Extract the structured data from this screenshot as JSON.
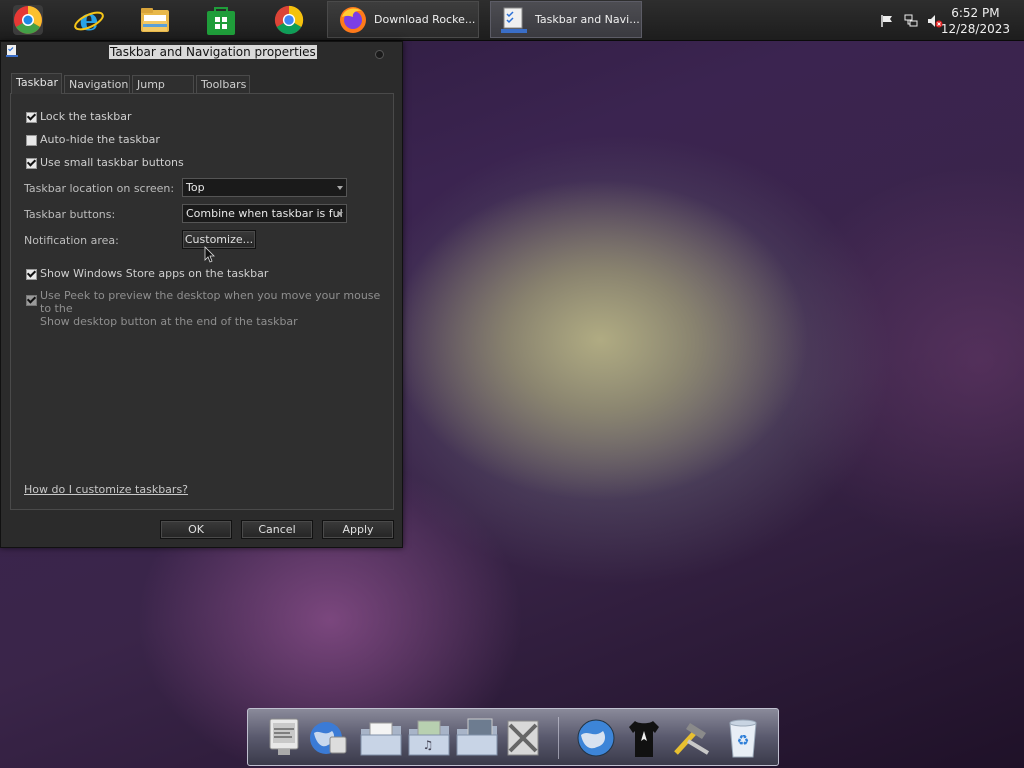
{
  "taskbar": {
    "pinned": [
      {
        "name": "chrome-canary",
        "icon": "chrome-color-icon"
      },
      {
        "name": "internet-explorer",
        "icon": "ie-icon"
      },
      {
        "name": "file-explorer",
        "icon": "folder-icon"
      },
      {
        "name": "windows-store",
        "icon": "store-icon"
      },
      {
        "name": "google-chrome",
        "icon": "chrome-icon"
      }
    ],
    "tasks": [
      {
        "label": "Download Rocke...",
        "icon": "firefox-icon",
        "active": false
      },
      {
        "label": "Taskbar and Navi...",
        "icon": "taskbar-properties-icon",
        "active": true
      }
    ],
    "tray": {
      "icons": [
        "flag-icon",
        "network-icon",
        "volume-muted-icon"
      ],
      "time": "6:52 PM",
      "date": "12/28/2023"
    }
  },
  "dialog": {
    "title": "Taskbar and Navigation properties",
    "tabs": [
      "Taskbar",
      "Navigation",
      "Jump Lists",
      "Toolbars"
    ],
    "selected_tab": "Taskbar",
    "checkboxes": {
      "lock": {
        "label": "Lock the taskbar",
        "checked": true
      },
      "autohide": {
        "label": "Auto-hide the taskbar",
        "checked": false
      },
      "small_buttons": {
        "label": "Use small taskbar buttons",
        "checked": true
      },
      "store_apps": {
        "label": "Show Windows Store apps on the taskbar",
        "checked": true
      },
      "peek": {
        "label_line1": "Use Peek to preview the desktop when you move your mouse to the",
        "label_line2": "Show desktop button at the end of the taskbar",
        "checked": true,
        "disabled": true
      }
    },
    "location": {
      "label": "Taskbar location on screen:",
      "value": "Top"
    },
    "buttons_setting": {
      "label": "Taskbar buttons:",
      "value": "Combine when taskbar is ful"
    },
    "notification": {
      "label": "Notification area:",
      "button": "Customize..."
    },
    "help_link": "How do I customize taskbars?",
    "ok": "OK",
    "cancel": "Cancel",
    "apply": "Apply"
  },
  "dock": {
    "items": [
      "system-monitor-icon",
      "globe-network-icon",
      "documents-folder-icon",
      "music-folder-icon",
      "pictures-folder-icon",
      "tools-icon",
      "browser-globe-icon",
      "tshirt-icon",
      "hammer-icon",
      "recycle-bin-icon"
    ]
  }
}
